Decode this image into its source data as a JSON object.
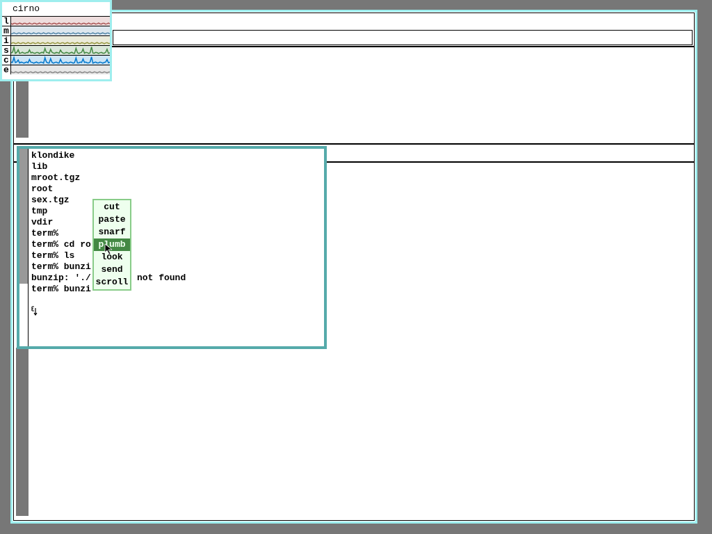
{
  "stats": {
    "host": "cirno",
    "meters": [
      {
        "label": "l",
        "color": "#aa5555"
      },
      {
        "label": "m",
        "color": "#5588aa"
      },
      {
        "label": "i",
        "color": "#999944"
      },
      {
        "label": "s",
        "color": "#448844"
      },
      {
        "label": "c",
        "color": "#0077cc"
      },
      {
        "label": "e",
        "color": "#888888"
      }
    ]
  },
  "terminal": {
    "lines": [
      {
        "text": "klondike"
      },
      {
        "text": "lib"
      },
      {
        "text": "mroot.tgz"
      },
      {
        "text": "root"
      },
      {
        "text": "sex.tgz"
      },
      {
        "text": "tmp"
      },
      {
        "text": "vdir"
      },
      {
        "text": "term%"
      },
      {
        "text": "term% cd ro"
      },
      {
        "text": "term% ls"
      },
      {
        "text": "term% bunzi"
      },
      {
        "text": "bunzip: './",
        "tail": "not found"
      },
      {
        "text": "term% bunzi"
      }
    ]
  },
  "menu": {
    "items": [
      {
        "label": "cut",
        "selected": false
      },
      {
        "label": "paste",
        "selected": false
      },
      {
        "label": "snarf",
        "selected": false
      },
      {
        "label": "plumb",
        "selected": true
      },
      {
        "label": "look",
        "selected": false
      },
      {
        "label": "send",
        "selected": false
      },
      {
        "label": "scroll",
        "selected": false
      }
    ]
  }
}
